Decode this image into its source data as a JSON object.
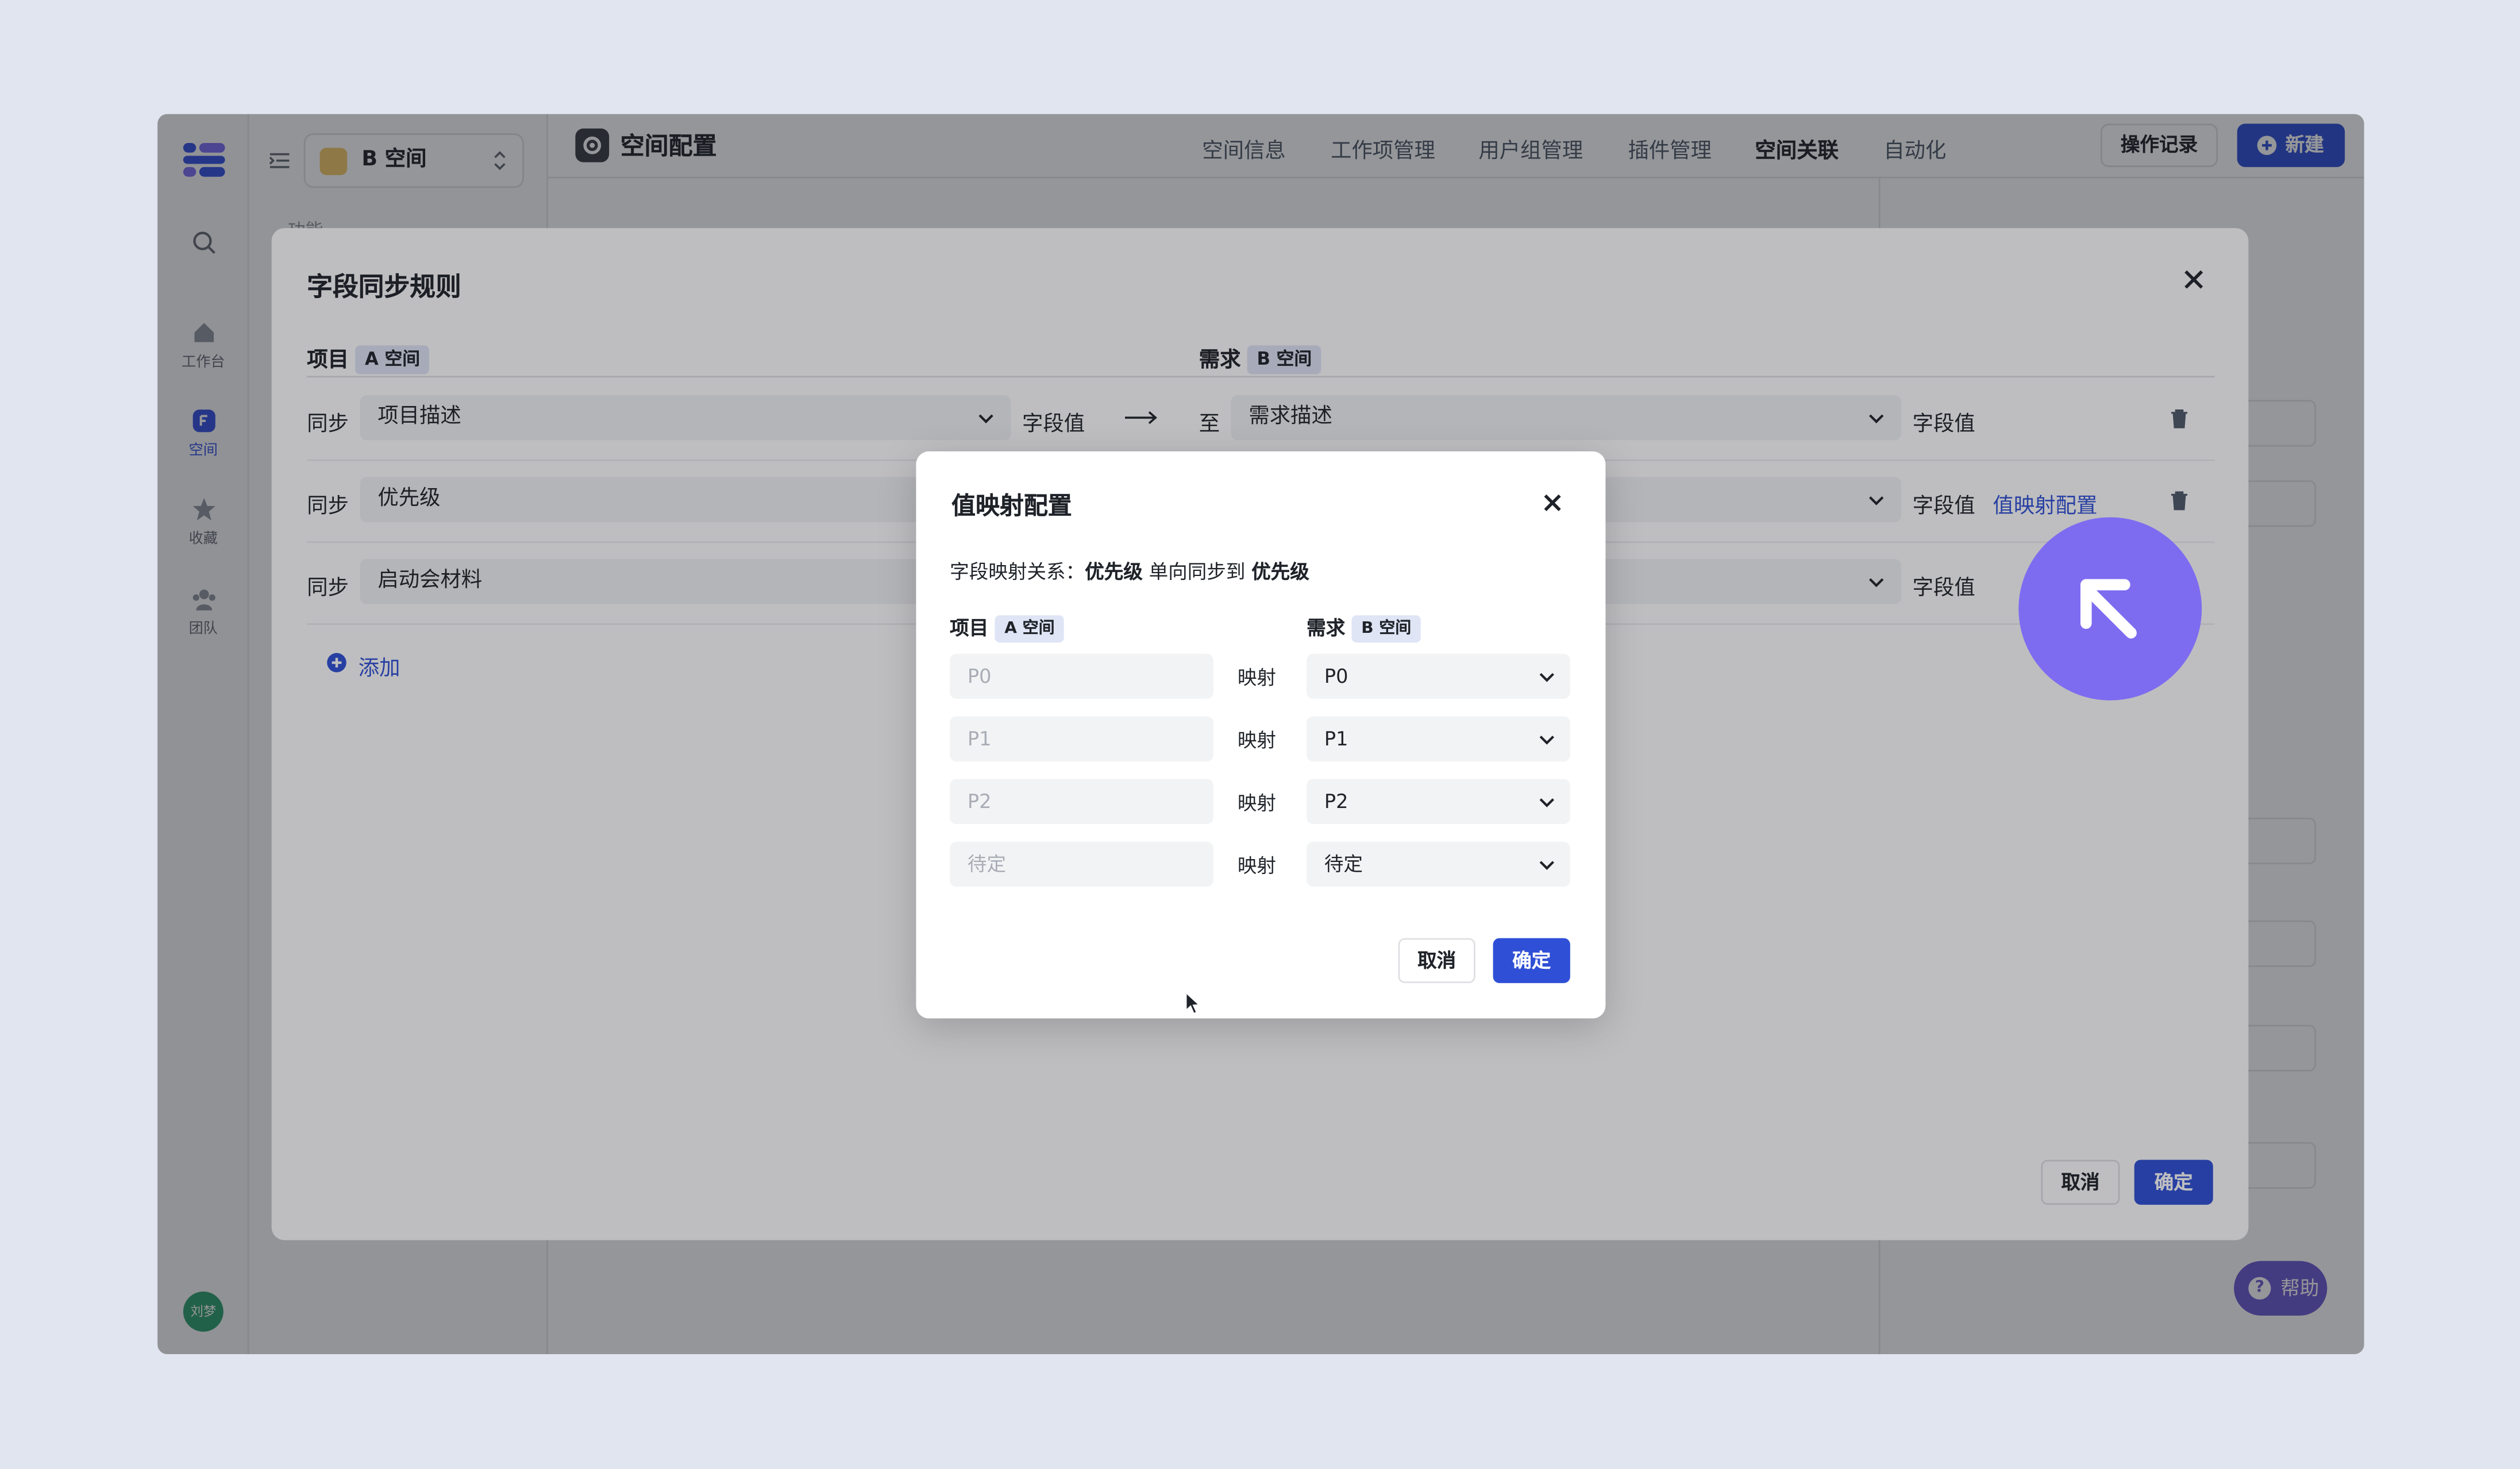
{
  "rail": {
    "items": [
      {
        "label": "",
        "icon": "search-icon"
      },
      {
        "label": "工作台",
        "icon": "home-icon"
      },
      {
        "label": "空间",
        "icon": "space-icon",
        "active": true
      },
      {
        "label": "收藏",
        "icon": "star-icon"
      },
      {
        "label": "团队",
        "icon": "team-icon"
      }
    ],
    "avatar": "刘梦"
  },
  "space_selector": {
    "name": "B 空间"
  },
  "sidebar": {
    "section_label": "功能"
  },
  "header": {
    "title": "空间配置",
    "tabs": [
      "空间信息",
      "工作项管理",
      "用户组管理",
      "插件管理",
      "空间关联",
      "自动化"
    ],
    "active_tab": "空间关联",
    "log_button": "操作记录",
    "new_button": "新建"
  },
  "background": {
    "help_label": "帮助"
  },
  "field_sync": {
    "title": "字段同步规则",
    "left_head": {
      "label": "项目",
      "tag": "A 空间"
    },
    "right_head": {
      "label": "需求",
      "tag": "B 空间"
    },
    "rows": [
      {
        "sync": "同步",
        "source": "项目描述",
        "value_type": "字段值",
        "to": "至",
        "target": "需求描述",
        "target_value_type": "字段值",
        "extra_link": ""
      },
      {
        "sync": "同步",
        "source": "优先级",
        "value_type": "",
        "to": "",
        "target": "",
        "target_value_type": "字段值",
        "extra_link": "值映射配置"
      },
      {
        "sync": "同步",
        "source": "启动会材料",
        "value_type": "",
        "to": "",
        "target": "",
        "target_value_type": "字段值",
        "extra_link": ""
      }
    ],
    "add_label": "添加",
    "cancel_label": "取消",
    "ok_label": "确定"
  },
  "value_mapping": {
    "title": "值映射配置",
    "relation_prefix": "字段映射关系：",
    "relation_source": "优先级",
    "relation_middle": " 单向同步到 ",
    "relation_target": "优先级",
    "left_head": {
      "label": "项目",
      "tag": "A 空间"
    },
    "right_head": {
      "label": "需求",
      "tag": "B 空间"
    },
    "map_label": "映射",
    "rows": [
      {
        "source_placeholder": "P0",
        "target": "P0"
      },
      {
        "source_placeholder": "P1",
        "target": "P1"
      },
      {
        "source_placeholder": "P2",
        "target": "P2"
      },
      {
        "source_placeholder": "待定",
        "target": "待定"
      }
    ],
    "cancel_label": "取消",
    "ok_label": "确定"
  },
  "colors": {
    "accent": "#2f4fd6",
    "cursor_circle": "#7d6cf0",
    "page_bg": "#e0e5f0"
  }
}
